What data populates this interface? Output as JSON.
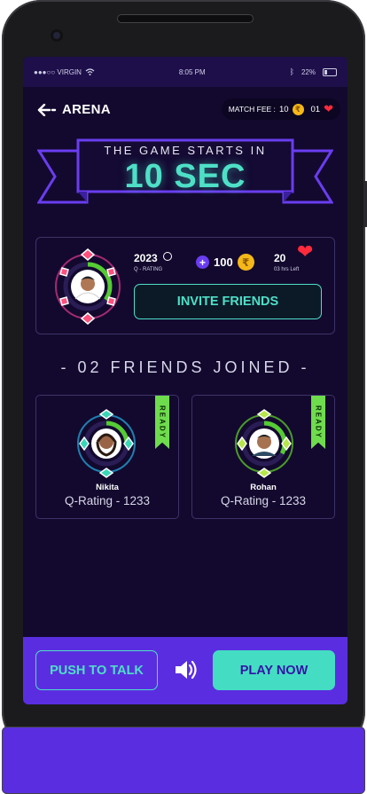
{
  "status_bar": {
    "carrier": "●●●○○ VIRGIN",
    "time": "8:05 PM",
    "battery": "22%"
  },
  "header": {
    "title": "ARENA",
    "match_fee_label": "MATCH FEE :",
    "fee_coins": "10",
    "fee_lives": "01"
  },
  "banner": {
    "line1": "THE GAME STARTS IN",
    "countdown": "10 SEC"
  },
  "player": {
    "rating": "2023",
    "rating_label": "Q - RATING",
    "coins": "100",
    "lives": "20",
    "lives_label": "03 hrs Left",
    "progress_fraction": 0.35
  },
  "invite_label": "INVITE FRIENDS",
  "friends_title": "- 02 FRIENDS JOINED -",
  "friends": [
    {
      "name": "Nikita",
      "rating": "Q-Rating - 1233",
      "status": "READY",
      "progress_fraction": 0.25
    },
    {
      "name": "Rohan",
      "rating": "Q-Rating - 1233",
      "status": "READY",
      "progress_fraction": 0.33
    }
  ],
  "bottom": {
    "push_to_talk": "PUSH TO TALK",
    "play_now": "PLAY NOW"
  },
  "colors": {
    "accent_teal": "#4ee0c7",
    "purple": "#5a2ee0",
    "ready_green": "#6fdc4e",
    "background": "#13092e"
  }
}
